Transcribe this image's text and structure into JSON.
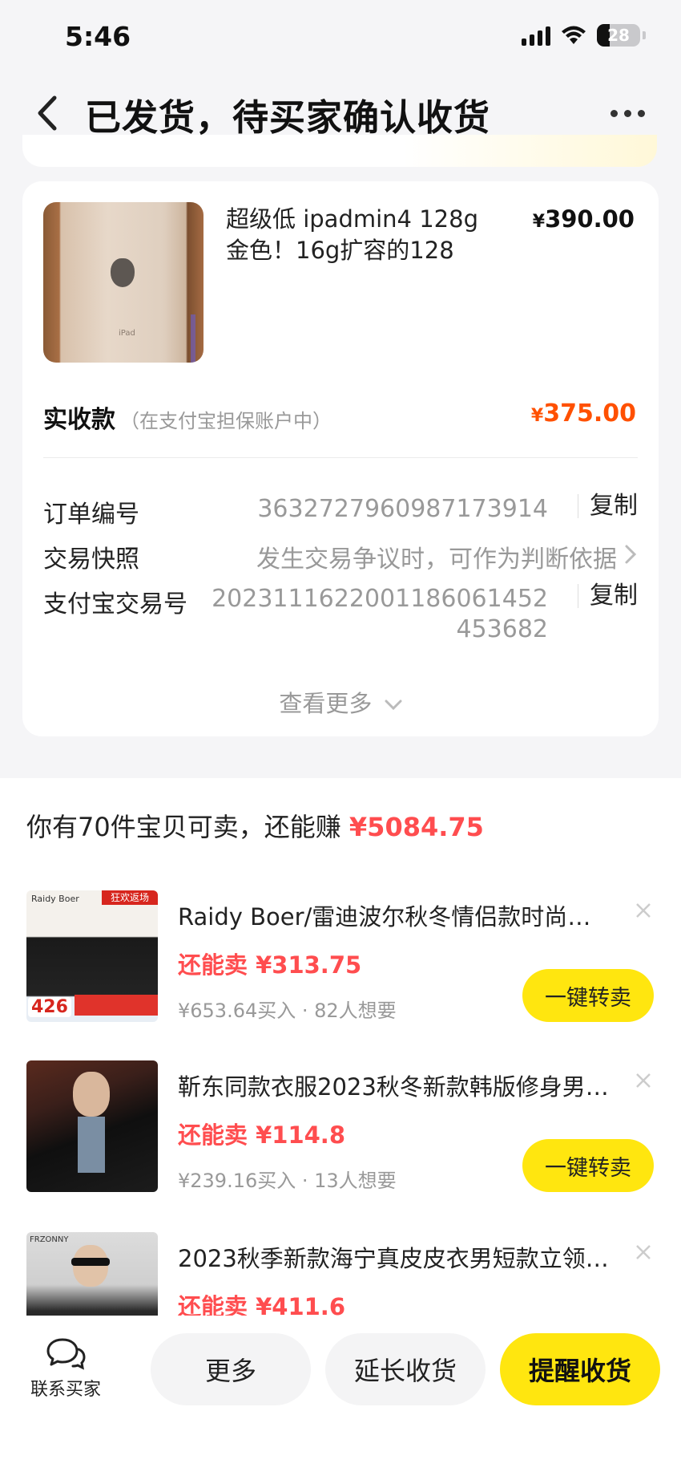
{
  "status_bar": {
    "time": "5:46",
    "battery": "28"
  },
  "nav": {
    "title": "已发货，待买家确认收货"
  },
  "order": {
    "product_title": "超级低 ipadmin4 128g 金色！16g扩容的128",
    "price_symbol": "¥",
    "price": "390.00",
    "received_label": "实收款",
    "received_note": "（在支付宝担保账户中）",
    "received_symbol": "¥",
    "received_amount": "375.00",
    "rows": {
      "order_no": {
        "label": "订单编号",
        "value": "3632727960987173914",
        "action": "复制"
      },
      "snapshot": {
        "label": "交易快照",
        "value": "发生交易争议时，可作为判断依据"
      },
      "alipay_no": {
        "label": "支付宝交易号",
        "value_line1": "20231116220011860614­52",
        "value_line2": "453682",
        "action": "复制"
      }
    },
    "see_more": "查看更多"
  },
  "resell": {
    "head_prefix": "你有70件宝贝可卖，还能赚 ",
    "head_amount": "¥5084.75",
    "items": [
      {
        "title": "Raidy Boer/雷迪波尔秋冬情侣款时尚休…",
        "sell": "还能卖 ¥313.75",
        "meta": "¥653.64买入 · 82人想要",
        "button": "一键转卖"
      },
      {
        "title": "靳东同款衣服2023秋冬新款韩版修身男…",
        "sell": "还能卖 ¥114.8",
        "meta": "¥239.16买入 · 13人想要",
        "button": "一键转卖"
      },
      {
        "title": "2023秋季新款海宁真皮皮衣男短款立领…",
        "sell": "还能卖 ¥411.6",
        "meta": "",
        "button": ""
      }
    ],
    "thumb_texts": {
      "t1_tag": "狂欢返场",
      "t1_brand": "Raidy Boer",
      "t1_badge": "426",
      "t3_logo": "FRZONNY"
    }
  },
  "bottom": {
    "contact": "联系买家",
    "more": "更多",
    "extend": "延长收货",
    "remind": "提醒收货"
  },
  "colors": {
    "accent_yellow": "#ffe60f",
    "price_orange": "#ff5000",
    "red": "#ff4d4f"
  },
  "icons": [
    "back-icon",
    "more-icon",
    "chevron-right-icon",
    "chevron-down-icon",
    "close-icon",
    "chat-icon",
    "signal-icon",
    "wifi-icon",
    "battery-icon"
  ]
}
